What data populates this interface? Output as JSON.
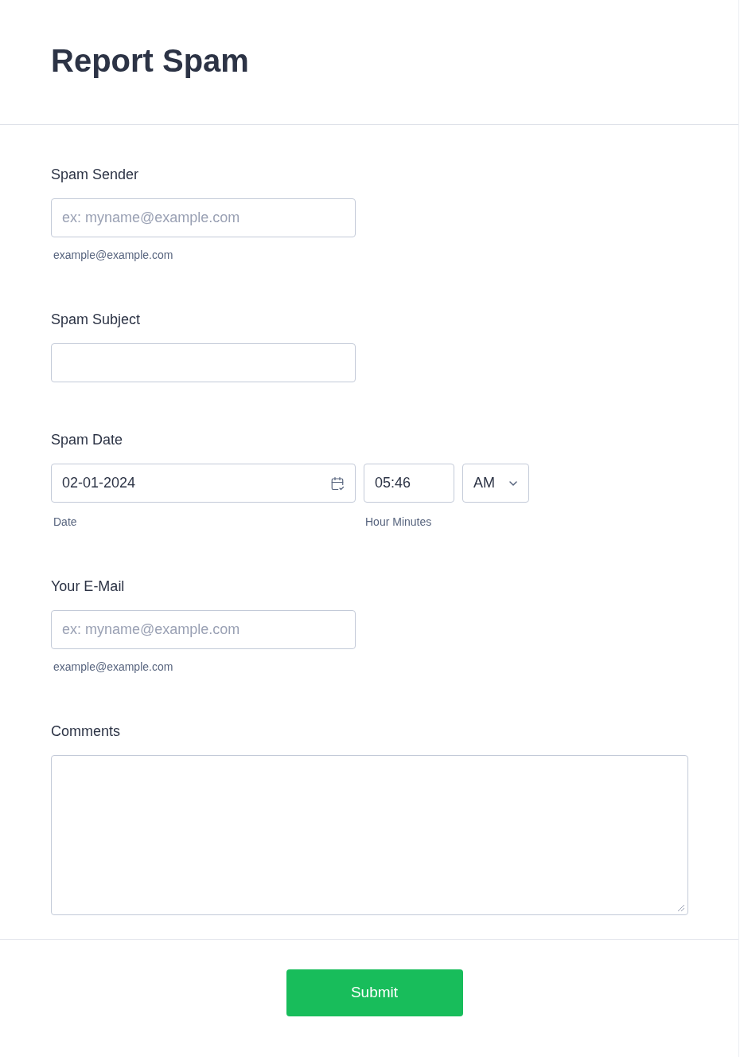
{
  "form": {
    "title": "Report Spam",
    "fields": [
      {
        "kind": "text",
        "label": "Spam Sender",
        "placeholder": "ex: myname@example.com",
        "sublabel": "example@example.com"
      },
      {
        "kind": "text",
        "label": "Spam Subject"
      },
      {
        "kind": "datetime",
        "label": "Spam Date",
        "date": {
          "value": "02-01-2024",
          "sublabel": "Date"
        },
        "time": {
          "value": "05:46",
          "sublabel": "Hour Minutes"
        },
        "period": {
          "value": "AM"
        }
      },
      {
        "kind": "text",
        "label": "Your E-Mail",
        "placeholder": "ex: myname@example.com",
        "sublabel": "example@example.com"
      },
      {
        "kind": "textarea",
        "label": "Comments"
      }
    ],
    "submit": {
      "label": "Submit"
    }
  }
}
